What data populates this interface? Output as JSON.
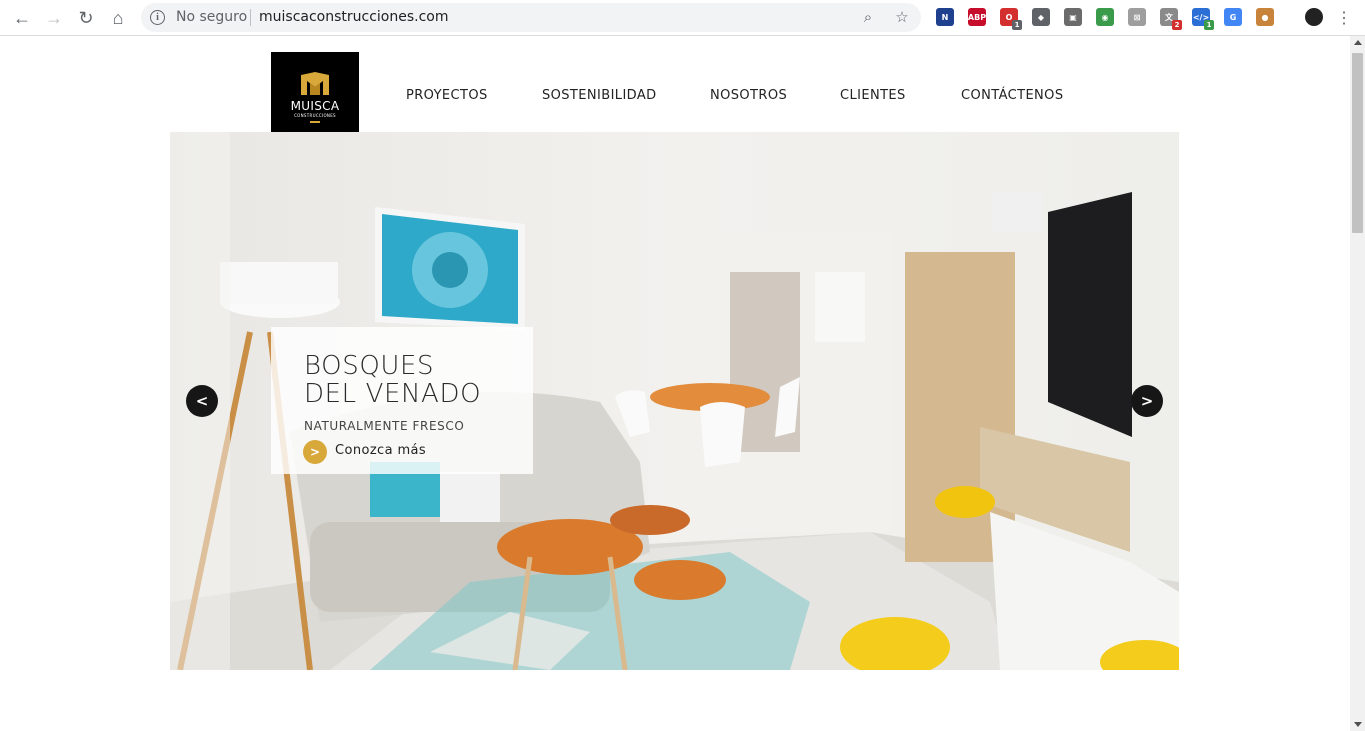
{
  "browser": {
    "security_label": "No seguro",
    "url": "muiscaconstrucciones.com",
    "extensions": [
      {
        "icon": "n-ext-icon",
        "label": "N",
        "color": "#1f3f8f",
        "badge": ""
      },
      {
        "icon": "adblock-icon",
        "label": "ABP",
        "color": "#c70d2c",
        "badge": ""
      },
      {
        "icon": "opera-icon",
        "label": "O",
        "color": "#d32f2f",
        "badge": "1"
      },
      {
        "icon": "shield-ext-icon",
        "label": "◆",
        "color": "#5f6368",
        "badge": ""
      },
      {
        "icon": "bag-ext-icon",
        "label": "▣",
        "color": "#6b6b6b",
        "badge": ""
      },
      {
        "icon": "color-picker-icon",
        "label": "◉",
        "color": "#3a9b4a",
        "badge": ""
      },
      {
        "icon": "pdf-ext-icon",
        "label": "⊠",
        "color": "#9e9e9e",
        "badge": ""
      },
      {
        "icon": "translate-ext-icon",
        "label": "文",
        "color": "#8a8a8a",
        "badge": "2"
      },
      {
        "icon": "code-ext-icon",
        "label": "</>",
        "color": "#2b6fd6",
        "badge": "1"
      },
      {
        "icon": "google-translate-icon",
        "label": "G",
        "color": "#4285f4",
        "badge": ""
      },
      {
        "icon": "cookie-icon",
        "label": "●",
        "color": "#c8843b",
        "badge": ""
      }
    ]
  },
  "logo": {
    "name": "MUISCA",
    "sub": "CONSTRUCCIONES"
  },
  "nav": {
    "items": [
      "PROYECTOS",
      "SOSTENIBILIDAD",
      "NOSOTROS",
      "CLIENTES",
      "CONTÁCTENOS"
    ]
  },
  "slider": {
    "title_line1": "BOSQUES",
    "title_line2": "DEL VENADO",
    "subtitle": "NATURALMENTE FRESCO",
    "cta_icon": ">",
    "cta_label": "Conozca más",
    "prev_label": "<",
    "next_label": ">"
  },
  "colors": {
    "accent": "#d8a93a",
    "logo_bg": "#000000"
  }
}
